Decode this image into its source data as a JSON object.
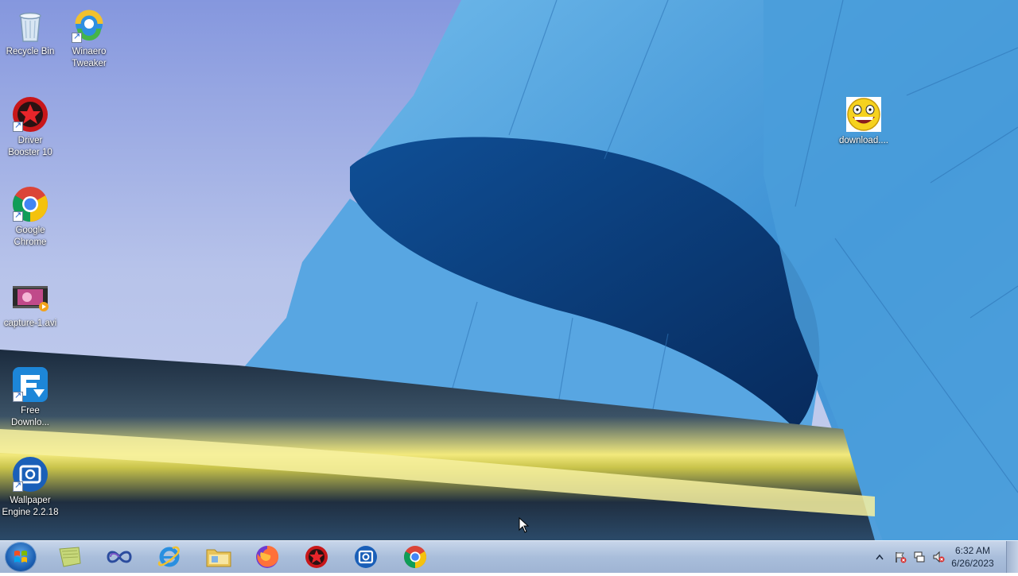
{
  "desktop": {
    "icons": [
      {
        "label": "Recycle Bin"
      },
      {
        "label": "Winaero",
        "label2": "Tweaker"
      },
      {
        "label": "Driver",
        "label2": "Booster 10"
      },
      {
        "label": "Google",
        "label2": "Chrome"
      },
      {
        "label": "capture-1.avi"
      },
      {
        "label": "Free",
        "label2": "Downlo..."
      },
      {
        "label": "Wallpaper",
        "label2": "Engine 2.2.18"
      },
      {
        "label": "download...."
      }
    ]
  },
  "taskbar": {
    "pinned": [
      {
        "name": "sticky-notes"
      },
      {
        "name": "infinity-app"
      },
      {
        "name": "internet-explorer"
      },
      {
        "name": "file-explorer"
      },
      {
        "name": "firefox"
      },
      {
        "name": "driver-booster"
      },
      {
        "name": "wallpaper-engine"
      },
      {
        "name": "google-chrome"
      }
    ],
    "tray": {
      "time": "6:32 AM",
      "date": "6/26/2023"
    }
  }
}
